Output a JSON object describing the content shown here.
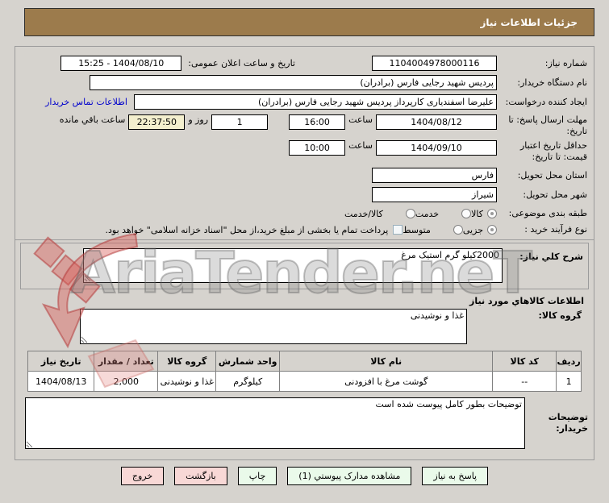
{
  "title_bar": {
    "text": "جزئیات اطلاعات نیاز"
  },
  "form": {
    "need_number": {
      "label": "شماره نیاز:",
      "value": "1104004978000116"
    },
    "announce": {
      "label": "تاریخ و ساعت اعلان عمومی:",
      "value": "1404/08/10 - 15:25"
    },
    "buyer_org": {
      "label": "نام دستگاه خریدار:",
      "value": "پردیس شهید رجایی فارس (برادران)"
    },
    "creator": {
      "label": "ایجاد کننده درخواست:",
      "value": "علیرضا اسفندیاری کارپرداز پردیس شهید رجایی فارس (برادران)",
      "link": "اطلاعات تماس خریدار"
    },
    "deadline": {
      "label": "مهلت ارسال پاسخ: تا تاریخ:",
      "date": "1404/08/12",
      "hour_label": "ساعت",
      "time": "16:00",
      "days_value": "1",
      "days_label": "روز و",
      "countdown": "22:37:50",
      "remaining_label": "ساعت باقي مانده"
    },
    "validity": {
      "label": "حداقل تاریخ اعتبار قیمت: تا تاریخ:",
      "date": "1404/09/10",
      "hour_label": "ساعت",
      "time": "10:00"
    },
    "province": {
      "label": "استان محل تحویل:",
      "value": "فارس"
    },
    "city": {
      "label": "شهر محل تحویل:",
      "value": "شیراز"
    },
    "classification": {
      "label": "طبقه بندی موضوعی:",
      "options": [
        {
          "label": "کالا",
          "selected": true
        },
        {
          "label": "خدمت",
          "selected": false
        },
        {
          "label": "کالا/خدمت",
          "selected": false
        }
      ]
    },
    "process_type": {
      "label": "نوع فرآیند خرید :",
      "options": [
        {
          "label": "جزیی",
          "selected": true
        },
        {
          "label": "متوسط",
          "selected": false
        }
      ],
      "checkbox_label": "پرداخت تمام یا بخشی از مبلغ خرید،از محل \"اسناد خزانه اسلامی\" خواهد بود.",
      "checkbox_checked": false
    }
  },
  "description": {
    "label": "شرح کلي نیاز:",
    "value": "2000کیلو گرم استیک مرغ"
  },
  "goods_section": {
    "header": "اطلاعات کالاهاي مورد نیاز",
    "group": {
      "label": "گروه کالا:",
      "value": "غذا و نوشیدنی"
    },
    "table": {
      "headers": [
        "ردیف",
        "کد کالا",
        "نام کالا",
        "واحد شمارش",
        "گروه کالا",
        "تعداد / مقدار",
        "تاریخ نیاز"
      ],
      "rows": [
        [
          "1",
          "--",
          "گوشت مرغ با افزودنی",
          "کیلوگرم",
          "غذا و نوشیدنی",
          "2,000",
          "1404/08/13"
        ]
      ]
    }
  },
  "buyer_notes": {
    "label": "توضیحات خریدار:",
    "value": "توضیحات بطور کامل پیوست شده است"
  },
  "buttons": [
    {
      "label": "پاسخ به نیاز",
      "style": "green"
    },
    {
      "label": "مشاهده مدارک پیوستي (1)",
      "style": "green"
    },
    {
      "label": "چاپ",
      "style": "green"
    },
    {
      "label": "بازگشت",
      "style": "pink"
    },
    {
      "label": "خروج",
      "style": "pink"
    }
  ],
  "watermark": {
    "text": "AriaTender.neT"
  },
  "colors": {
    "header_brown": "#9c7b4c",
    "page_gray": "#d6d3ce",
    "countdown_beige": "#f3efce",
    "button_green": "#eafaea",
    "button_pink": "#f8d8d6",
    "link_blue": "#0000cc",
    "watermark_red": "#d9534f"
  }
}
